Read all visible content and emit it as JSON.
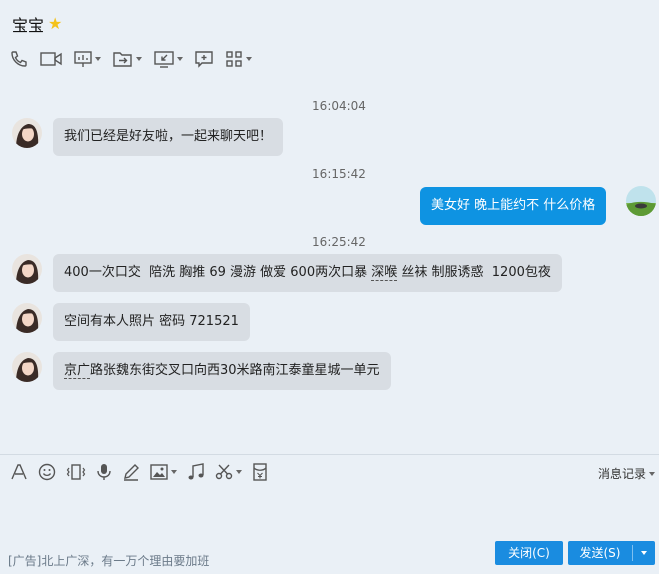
{
  "header": {
    "contact_name": "宝宝"
  },
  "messages": [
    {
      "type": "time",
      "text": "16:04:04"
    },
    {
      "type": "in",
      "text": "我们已经是好友啦，一起来聊天吧！"
    },
    {
      "type": "time",
      "text": "16:15:42"
    },
    {
      "type": "out",
      "text": "美女好  晚上能约不  什么价格"
    },
    {
      "type": "time",
      "text": "16:25:42"
    },
    {
      "type": "in",
      "text_a": "400一次口交  陪洗 胸推 69 漫游 做爱 600两次口暴 ",
      "text_b": "深喉",
      "text_c": " 丝袜 制服诱惑  1200包夜"
    },
    {
      "type": "in",
      "text": "空间有本人照片 密码 721521"
    },
    {
      "type": "in",
      "text_a": "京广",
      "text_b": "路张魏东街交叉口向西30米路南江泰童星城一单元"
    }
  ],
  "input": {
    "message_record_label": "消息记录"
  },
  "footer": {
    "ad_text": "[广告]北上广深，有一万个理由要加班",
    "close_label": "关闭(C)",
    "send_label": "发送(S)"
  },
  "colors": {
    "outgoing_bubble": "#0e93e2",
    "incoming_bubble": "#d8dde3",
    "button": "#1a8ce0"
  }
}
